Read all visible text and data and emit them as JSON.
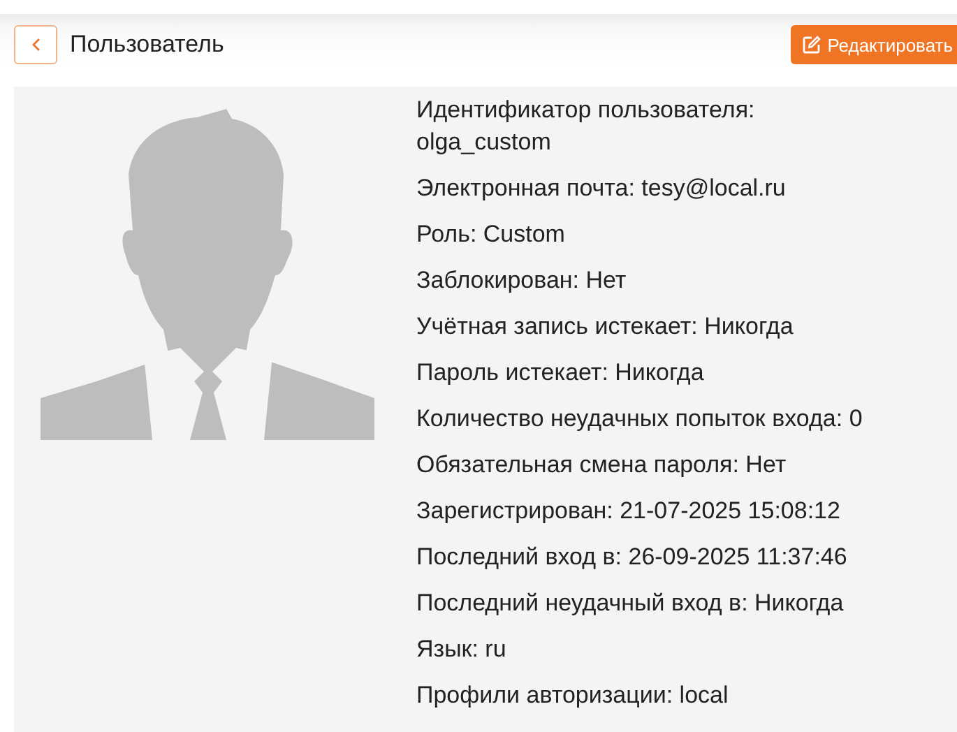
{
  "header": {
    "title": "Пользователь",
    "edit_button": "Редактировать"
  },
  "user": {
    "details": [
      {
        "kind": "stacked",
        "label": "Идентификатор пользователя:",
        "value": "olga_custom"
      },
      {
        "kind": "inline",
        "label": "Электронная почта:",
        "value": "tesy@local.ru"
      },
      {
        "kind": "inline",
        "label": "Роль:",
        "value": "Custom"
      },
      {
        "kind": "inline",
        "label": "Заблокирован:",
        "value": "Нет"
      },
      {
        "kind": "inline",
        "label": "Учётная запись истекает:",
        "value": "Никогда"
      },
      {
        "kind": "inline",
        "label": "Пароль истекает:",
        "value": "Никогда"
      },
      {
        "kind": "inline",
        "label": "Количество неудачных попыток входа:",
        "value": "0"
      },
      {
        "kind": "inline",
        "label": "Обязательная смена пароля:",
        "value": "Нет"
      },
      {
        "kind": "inline",
        "label": "Зарегистрирован:",
        "value": "21-07-2025 15:08:12"
      },
      {
        "kind": "inline",
        "label": "Последний вход в:",
        "value": "26-09-2025 11:37:46"
      },
      {
        "kind": "inline",
        "label": "Последний неудачный вход в:",
        "value": "Никогда"
      },
      {
        "kind": "inline",
        "label": "Язык:",
        "value": "ru"
      },
      {
        "kind": "inline",
        "label": "Профили авторизации:",
        "value": "local"
      }
    ]
  }
}
